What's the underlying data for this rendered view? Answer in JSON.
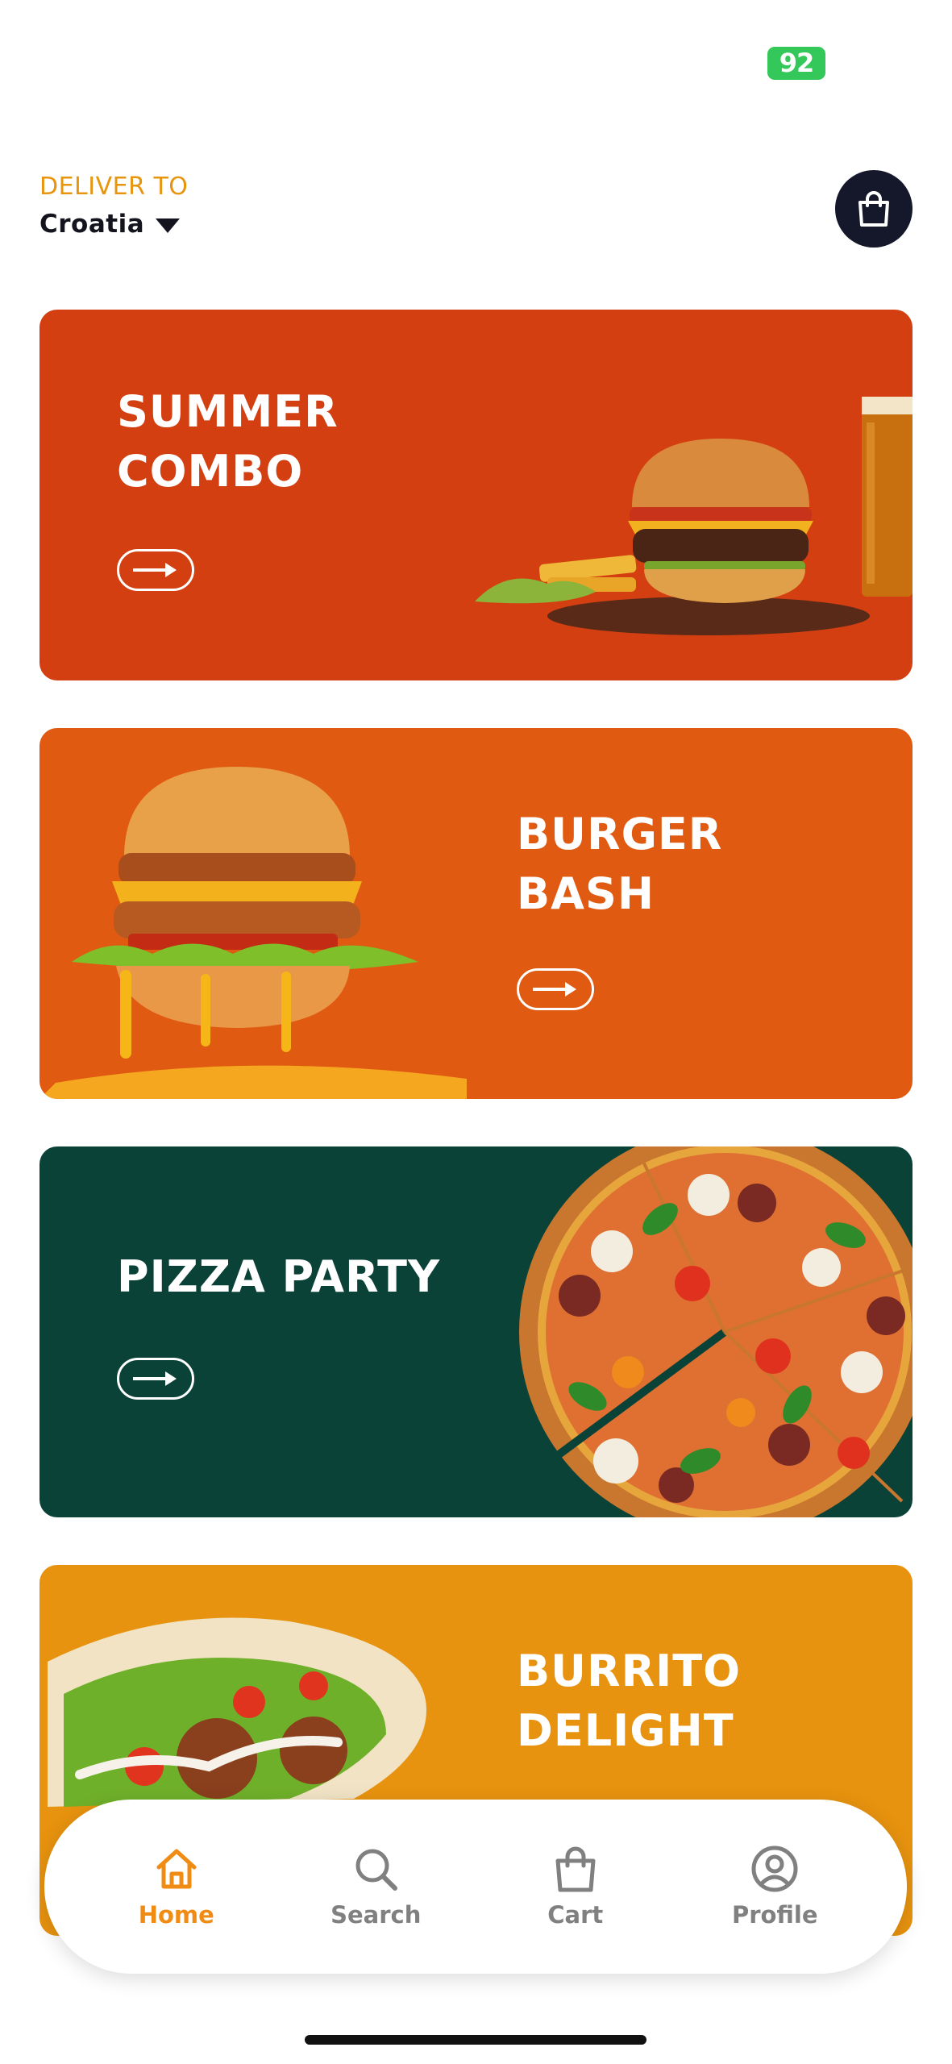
{
  "status_bar": {
    "battery": "92"
  },
  "header": {
    "deliver_label": "DELIVER TO",
    "location": "Croatia"
  },
  "promos": [
    {
      "title": "SUMMER\nCOMBO",
      "bg": "#d33f10"
    },
    {
      "title": "BURGER\nBASH",
      "bg": "#e05a12"
    },
    {
      "title": "PIZZA PARTY",
      "bg": "#0a4238"
    },
    {
      "title": "BURRITO\nDELIGHT",
      "bg": "#e8930f"
    }
  ],
  "nav": [
    {
      "label": "Home",
      "icon": "home-icon",
      "active": true
    },
    {
      "label": "Search",
      "icon": "search-icon"
    },
    {
      "label": "Cart",
      "icon": "bag-icon"
    },
    {
      "label": "Profile",
      "icon": "profile-icon"
    }
  ],
  "colors": {
    "accent": "#f08c14",
    "dark": "#14182a",
    "inactive": "#808080"
  }
}
